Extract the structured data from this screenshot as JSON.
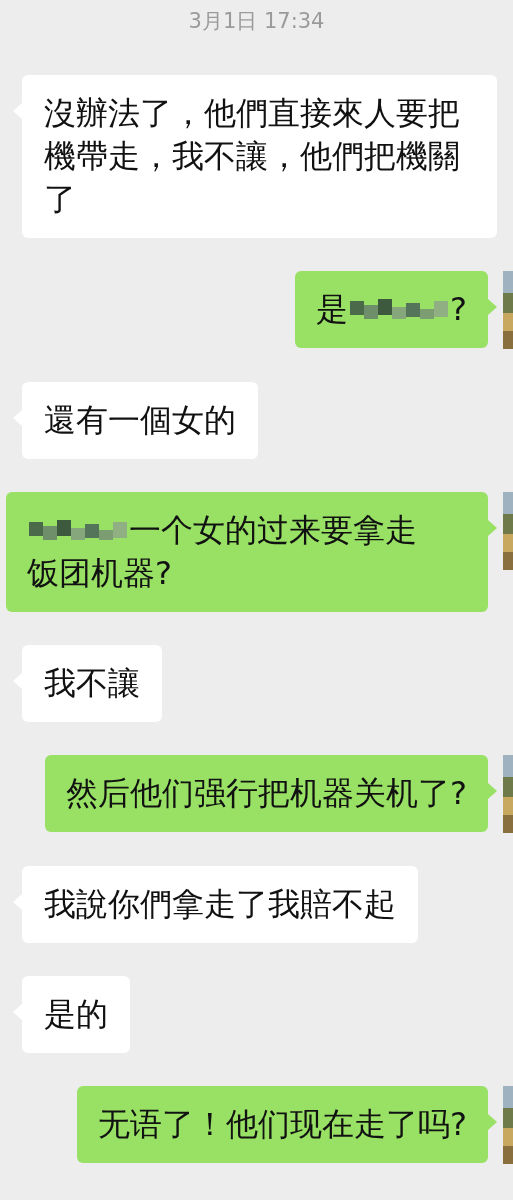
{
  "timestamp": "3月1日 17:34",
  "messages": [
    {
      "outgoing": false,
      "parts": [
        {
          "kind": "text",
          "text": "沒辦法了，他們直接來人要把機帶走，我不讓，他們把機關了"
        }
      ]
    },
    {
      "outgoing": true,
      "parts": [
        {
          "kind": "text",
          "text": "是"
        },
        {
          "kind": "redacted"
        },
        {
          "kind": "text",
          "text": "?"
        }
      ]
    },
    {
      "outgoing": false,
      "parts": [
        {
          "kind": "text",
          "text": "還有一個女的"
        }
      ]
    },
    {
      "outgoing": true,
      "parts": [
        {
          "kind": "redacted"
        },
        {
          "kind": "text",
          "text": "一个女的过来要拿走"
        },
        {
          "kind": "text",
          "text": "饭团机器?"
        }
      ]
    },
    {
      "outgoing": false,
      "parts": [
        {
          "kind": "text",
          "text": "我不讓"
        }
      ]
    },
    {
      "outgoing": true,
      "parts": [
        {
          "kind": "text",
          "text": "然后他们强行把机器关机了?"
        }
      ]
    },
    {
      "outgoing": false,
      "parts": [
        {
          "kind": "text",
          "text": "我說你們拿走了我賠不起"
        }
      ]
    },
    {
      "outgoing": false,
      "parts": [
        {
          "kind": "text",
          "text": "是的"
        }
      ]
    },
    {
      "outgoing": true,
      "parts": [
        {
          "kind": "text",
          "text": "无语了！他们现在走了吗?"
        }
      ]
    }
  ]
}
